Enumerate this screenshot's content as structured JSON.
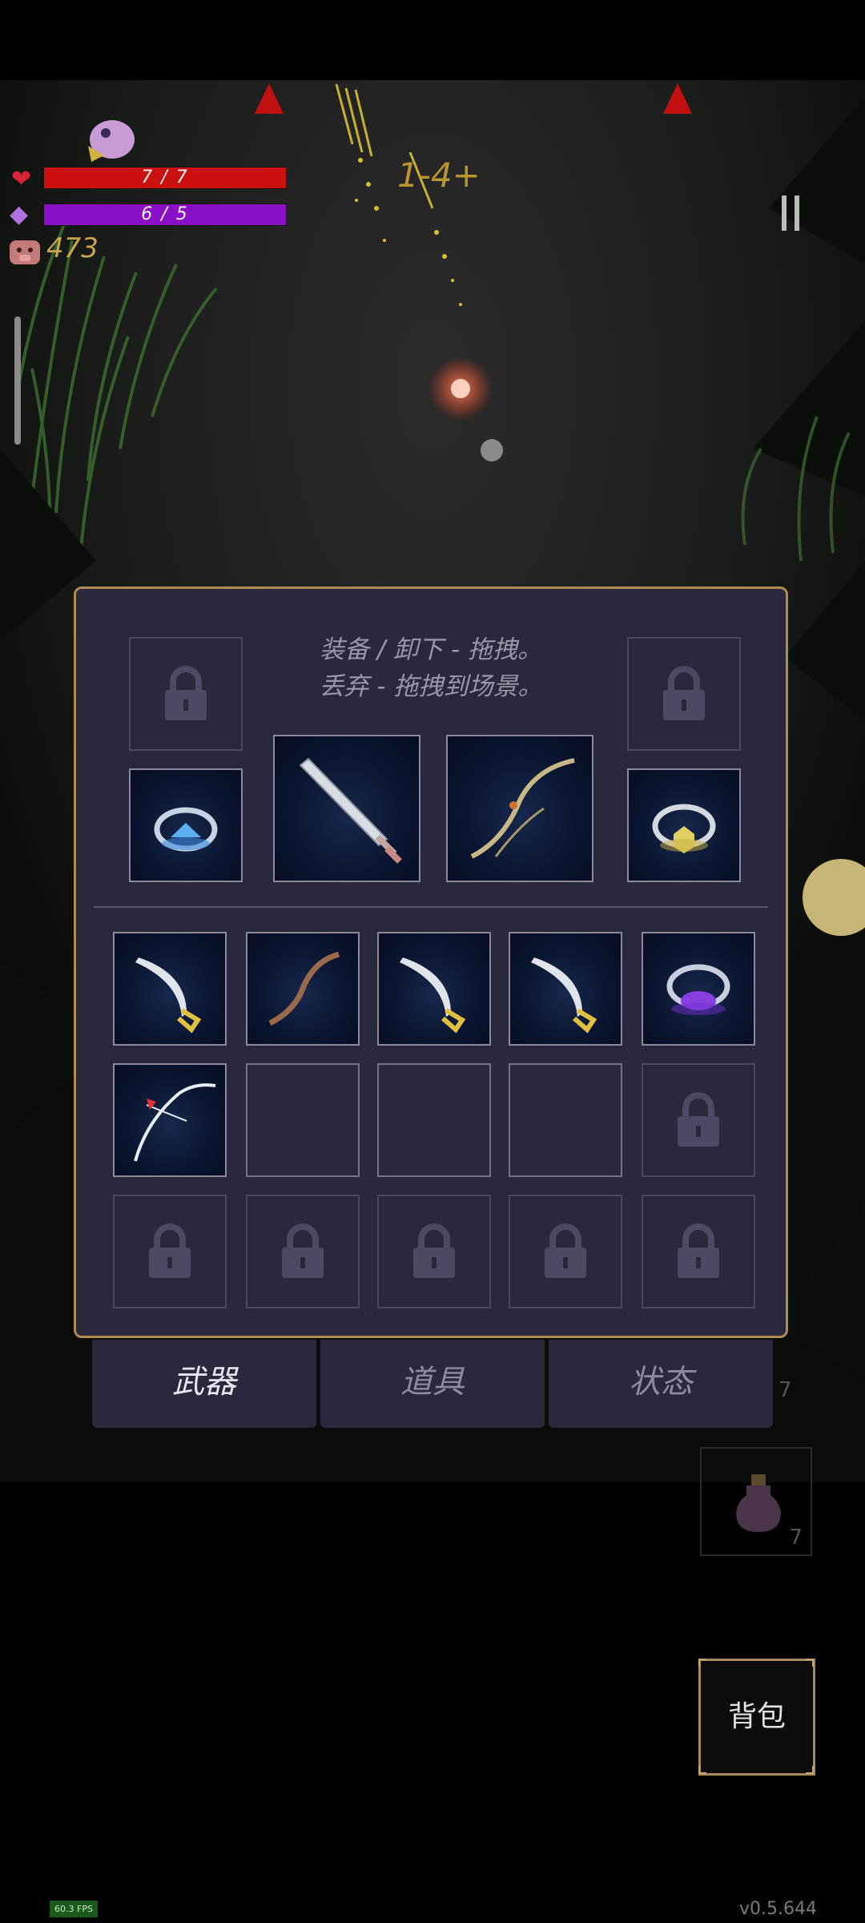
{
  "hud": {
    "health_text": "7 / 7",
    "mana_text": "6 / 5",
    "coin_count": "473",
    "floating_combat_text": "1-4+",
    "pause_icon": "pause-icon"
  },
  "colors": {
    "health": "#cc1010",
    "mana": "#8a10c8",
    "panel_bg": "#2a283d",
    "panel_border": "#b08a52",
    "gold": "#c9a64a"
  },
  "inventory": {
    "hint_line1": "装备 / 卸下 - 拖拽。",
    "hint_line2": "丢弃 - 拖拽到场景。",
    "equipped": [
      "sapphire-ring",
      "silver-sword",
      "wooden-bow",
      "gold-ring"
    ],
    "equipped_locked": 2,
    "bag_items": [
      "scimitar",
      "branch-bow",
      "scimitar",
      "scimitar",
      "amethyst-ring",
      "white-bow"
    ],
    "bag_empty": 3,
    "bag_locked": 6
  },
  "tabs": [
    "武器",
    "道具",
    "状态"
  ],
  "active_tab": 0,
  "backpack_label": "背包",
  "potion_count_top": "7",
  "potion_count_bottom": "7",
  "fps_text": "60.3 FPS",
  "version_text": "v0.5.644"
}
